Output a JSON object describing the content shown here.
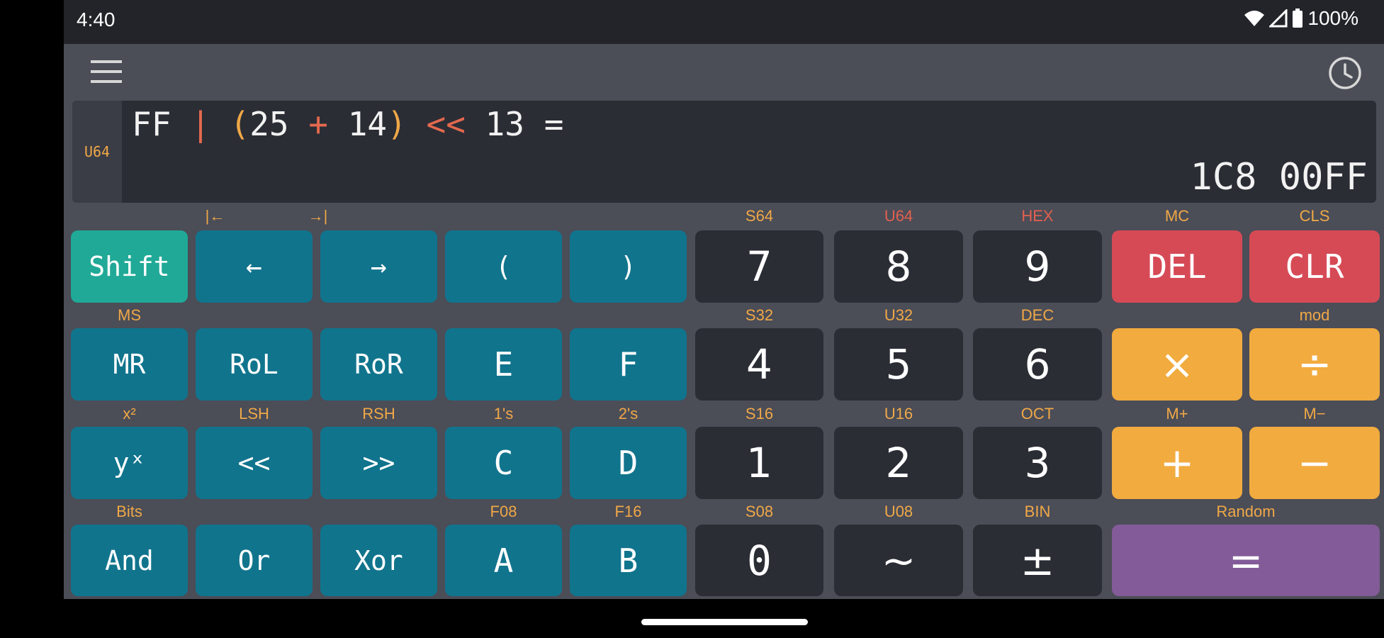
{
  "status": {
    "time": "4:40",
    "battery": "100%"
  },
  "display": {
    "mode": "U64",
    "expr": {
      "t1": "FF",
      "op1": "|",
      "p1": "(",
      "t2": "25",
      "op2": "+",
      "t3": "14",
      "p2": ")",
      "op3": "<<",
      "t4": "13",
      "t5": "="
    },
    "result": "1C8 00FF"
  },
  "keys": {
    "shift": "Shift",
    "left": "←",
    "right": "→",
    "lparen": "(",
    "rparen": ")",
    "seven": "7",
    "eight": "8",
    "nine": "9",
    "del": "DEL",
    "clr": "CLR",
    "mr": "MR",
    "rol": "RoL",
    "ror": "RoR",
    "e": "E",
    "f": "F",
    "four": "4",
    "five": "5",
    "six": "6",
    "mul": "×",
    "div": "÷",
    "pow": "yˣ",
    "lsh": "<<",
    "rsh": ">>",
    "c": "C",
    "d": "D",
    "one": "1",
    "two": "2",
    "three": "3",
    "plus": "+",
    "minus": "−",
    "and": "And",
    "or": "Or",
    "xor": "Xor",
    "a": "A",
    "b": "B",
    "zero": "0",
    "not": "~",
    "neg": "±",
    "equals": "="
  },
  "labels": {
    "home": "|←",
    "end": "→|",
    "s64": "S64",
    "u64": "U64",
    "hex": "HEX",
    "mc": "MC",
    "cls": "CLS",
    "ms": "MS",
    "s32": "S32",
    "u32": "U32",
    "dec": "DEC",
    "mod": "mod",
    "x2": "x²",
    "lsh": "LSH",
    "rsh": "RSH",
    "ones": "1's",
    "twos": "2's",
    "s16": "S16",
    "u16": "U16",
    "oct": "OCT",
    "mplus": "M+",
    "mminus": "M−",
    "bits": "Bits",
    "f08": "F08",
    "f16": "F16",
    "s08": "S08",
    "u08": "U08",
    "bin": "BIN",
    "random": "Random"
  },
  "colors": {
    "teal": "#11748d",
    "shift": "#20a996",
    "dark": "#2b2d35",
    "red": "#d64a56",
    "orange": "#f2ab3e",
    "purple": "#825b98",
    "label": "#f0a847",
    "label_red": "#e3604f"
  },
  "icons": {
    "menu": "hamburger-menu-icon",
    "history": "clock-icon",
    "wifi": "wifi-icon",
    "signal": "signal-icon",
    "battery": "battery-icon"
  }
}
